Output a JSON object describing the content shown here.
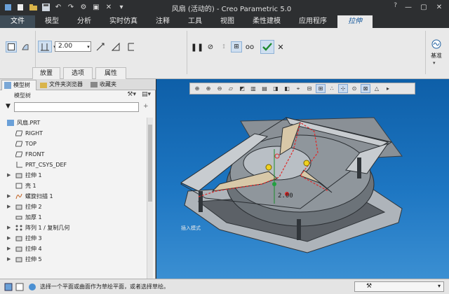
{
  "window": {
    "title": "风扇 (活动的) - Creo Parametric 5.0"
  },
  "ribbon_tabs": [
    {
      "label": "文件"
    },
    {
      "label": "模型"
    },
    {
      "label": "分析"
    },
    {
      "label": "实时仿真"
    },
    {
      "label": "注释"
    },
    {
      "label": "工具"
    },
    {
      "label": "视图"
    },
    {
      "label": "柔性建模"
    },
    {
      "label": "应用程序"
    },
    {
      "label": "拉伸"
    }
  ],
  "extrude": {
    "depth_value": "2.00",
    "sub_tabs": [
      "放置",
      "选项",
      "属性"
    ],
    "side_label": "基准"
  },
  "left_panel": {
    "tabs": [
      "模型树",
      "文件夹浏览器",
      "收藏夹"
    ],
    "tree_header": "模型树",
    "tree_items": [
      {
        "label": "风扇.PRT",
        "icon": "part-icon",
        "expandable": false,
        "indent": 0
      },
      {
        "label": "RIGHT",
        "icon": "datum-plane-icon",
        "expandable": false,
        "indent": 1
      },
      {
        "label": "TOP",
        "icon": "datum-plane-icon",
        "expandable": false,
        "indent": 1
      },
      {
        "label": "FRONT",
        "icon": "datum-plane-icon",
        "expandable": false,
        "indent": 1
      },
      {
        "label": "PRT_CSYS_DEF",
        "icon": "csys-icon",
        "expandable": false,
        "indent": 1
      },
      {
        "label": "拉伸 1",
        "icon": "extrude-icon",
        "expandable": true,
        "indent": 1
      },
      {
        "label": "壳 1",
        "icon": "shell-icon",
        "expandable": false,
        "indent": 1
      },
      {
        "label": "螺旋扫描 1",
        "icon": "helical-sweep-icon",
        "expandable": true,
        "indent": 1
      },
      {
        "label": "拉伸 2",
        "icon": "extrude-icon",
        "expandable": true,
        "indent": 1
      },
      {
        "label": "加厚 1",
        "icon": "thicken-icon",
        "expandable": false,
        "indent": 1
      },
      {
        "label": "阵列 1 / 复制几何",
        "icon": "pattern-icon",
        "expandable": true,
        "indent": 1
      },
      {
        "label": "拉伸 3",
        "icon": "extrude-icon",
        "expandable": true,
        "indent": 1
      },
      {
        "label": "拉伸 4",
        "icon": "extrude-icon",
        "expandable": true,
        "indent": 1
      },
      {
        "label": "拉伸 5",
        "icon": "extrude-icon",
        "expandable": true,
        "indent": 1
      }
    ]
  },
  "viewport": {
    "dimension_value": "2.00",
    "feature_label": "插入模式"
  },
  "status": {
    "message": "选择一个平面或曲面作为草绘平面，或者选择草绘。"
  },
  "colors": {
    "viewport_top": "#0e5fa8",
    "viewport_bottom": "#3b8fd2",
    "active_tab_text": "#2060a0",
    "accept_green": "#1e8a2e"
  }
}
